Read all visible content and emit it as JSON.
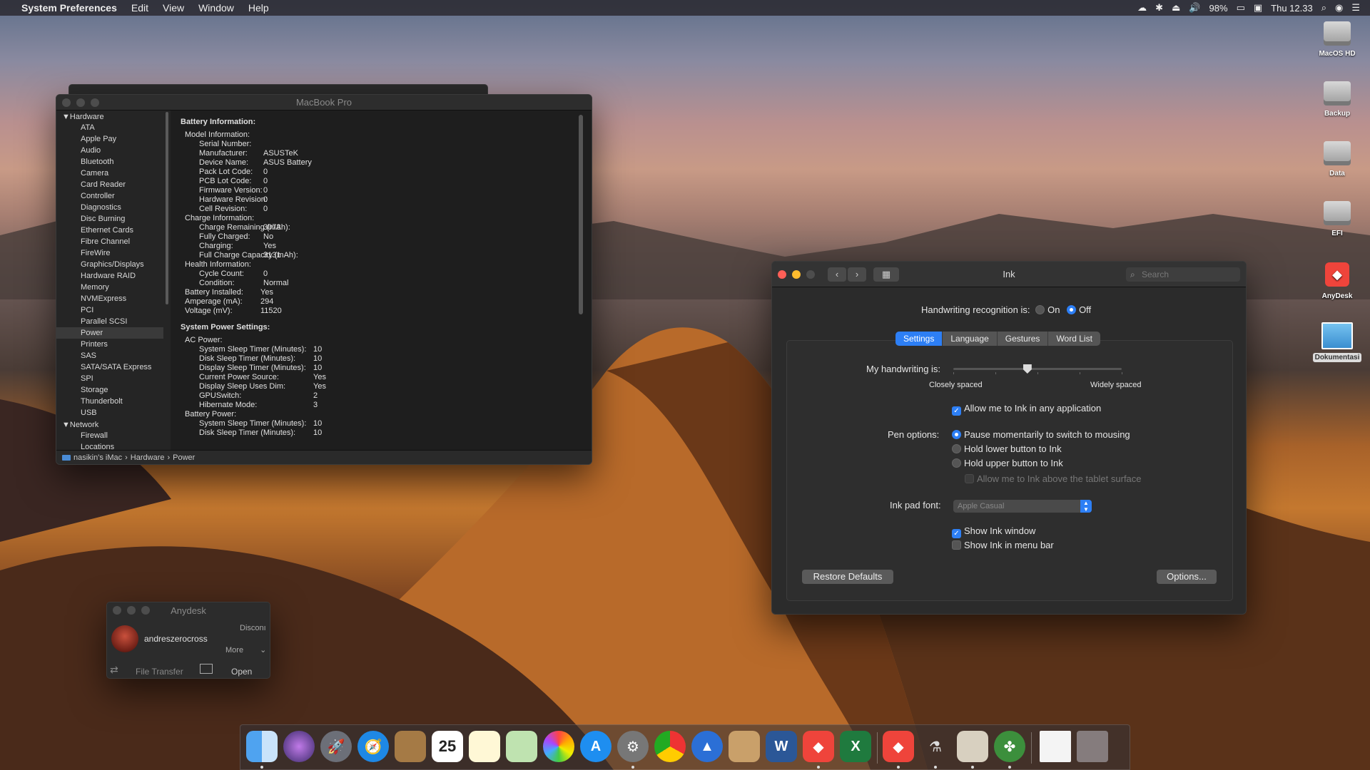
{
  "menubar": {
    "app": "System Preferences",
    "items": [
      "Edit",
      "View",
      "Window",
      "Help"
    ],
    "battery": "98%",
    "clock": "Thu 12.33"
  },
  "sysinfo": {
    "title": "MacBook Pro",
    "sidebar_hardware": "Hardware",
    "hardware_items": [
      "ATA",
      "Apple Pay",
      "Audio",
      "Bluetooth",
      "Camera",
      "Card Reader",
      "Controller",
      "Diagnostics",
      "Disc Burning",
      "Ethernet Cards",
      "Fibre Channel",
      "FireWire",
      "Graphics/Displays",
      "Hardware RAID",
      "Memory",
      "NVMExpress",
      "PCI",
      "Parallel SCSI",
      "Power",
      "Printers",
      "SAS",
      "SATA/SATA Express",
      "SPI",
      "Storage",
      "Thunderbolt",
      "USB"
    ],
    "selected_item": "Power",
    "sidebar_network": "Network",
    "network_items": [
      "Firewall",
      "Locations"
    ],
    "battery_heading": "Battery Information:",
    "battery_rows": [
      {
        "level": 1,
        "key": "Model Information:",
        "val": ""
      },
      {
        "level": 2,
        "key": "Serial Number:",
        "val": ""
      },
      {
        "level": 2,
        "key": "Manufacturer:",
        "val": "ASUSTeK"
      },
      {
        "level": 2,
        "key": "Device Name:",
        "val": "ASUS Battery"
      },
      {
        "level": 2,
        "key": "Pack Lot Code:",
        "val": "0"
      },
      {
        "level": 2,
        "key": "PCB Lot Code:",
        "val": "0"
      },
      {
        "level": 2,
        "key": "Firmware Version:",
        "val": "0"
      },
      {
        "level": 2,
        "key": "Hardware Revision:",
        "val": "0"
      },
      {
        "level": 2,
        "key": "Cell Revision:",
        "val": "0"
      },
      {
        "level": 1,
        "key": "Charge Information:",
        "val": ""
      },
      {
        "level": 2,
        "key": "Charge Remaining (mAh):",
        "val": "3073"
      },
      {
        "level": 2,
        "key": "Fully Charged:",
        "val": "No"
      },
      {
        "level": 2,
        "key": "Charging:",
        "val": "Yes"
      },
      {
        "level": 2,
        "key": "Full Charge Capacity (mAh):",
        "val": "3131"
      },
      {
        "level": 1,
        "key": "Health Information:",
        "val": ""
      },
      {
        "level": 2,
        "key": "Cycle Count:",
        "val": "0"
      },
      {
        "level": 2,
        "key": "Condition:",
        "val": "Normal"
      },
      {
        "level": 1,
        "key": "Battery Installed:",
        "val": "Yes"
      },
      {
        "level": 1,
        "key": "Amperage (mA):",
        "val": "294"
      },
      {
        "level": 1,
        "key": "Voltage (mV):",
        "val": "11520"
      }
    ],
    "power_heading": "System Power Settings:",
    "power_rows": [
      {
        "level": 1,
        "key": "AC Power:",
        "val": ""
      },
      {
        "level": 2,
        "key": "System Sleep Timer (Minutes):",
        "val": "10"
      },
      {
        "level": 2,
        "key": "Disk Sleep Timer (Minutes):",
        "val": "10"
      },
      {
        "level": 2,
        "key": "Display Sleep Timer (Minutes):",
        "val": "10"
      },
      {
        "level": 2,
        "key": "Current Power Source:",
        "val": "Yes"
      },
      {
        "level": 2,
        "key": "Display Sleep Uses Dim:",
        "val": "Yes"
      },
      {
        "level": 2,
        "key": "GPUSwitch:",
        "val": "2"
      },
      {
        "level": 2,
        "key": "Hibernate Mode:",
        "val": "3"
      },
      {
        "level": 1,
        "key": "Battery Power:",
        "val": ""
      },
      {
        "level": 2,
        "key": "System Sleep Timer (Minutes):",
        "val": "10"
      },
      {
        "level": 2,
        "key": "Disk Sleep Timer (Minutes):",
        "val": "10"
      }
    ],
    "path": [
      "nasikin's iMac",
      "Hardware",
      "Power"
    ]
  },
  "ink": {
    "title": "Ink",
    "search_placeholder": "Search",
    "recognition_label": "Handwriting recognition is:",
    "on": "On",
    "off": "Off",
    "tabs": [
      "Settings",
      "Language",
      "Gestures",
      "Word List"
    ],
    "handwriting_label": "My handwriting is:",
    "spacing_level": 0.44,
    "closely": "Closely spaced",
    "widely": "Widely spaced",
    "allow_any": "Allow me to Ink in any application",
    "pen_label": "Pen options:",
    "pen_opt1": "Pause momentarily to switch to mousing",
    "pen_opt2": "Hold lower button to Ink",
    "pen_opt3": "Hold upper button to Ink",
    "allow_above": "Allow me to Ink above the tablet surface",
    "font_label": "Ink pad font:",
    "font_value": "Apple Casual",
    "show_window": "Show Ink window",
    "show_menubar": "Show Ink in menu bar",
    "restore": "Restore Defaults",
    "options": "Options..."
  },
  "anydesk": {
    "title": "Anydesk",
    "user": "andreszerocross",
    "disconnect": "Disconı",
    "more": "More",
    "file_transfer": "File Transfer",
    "open_chat": "Open Cha"
  },
  "desktop": [
    "MacOS HD",
    "Backup",
    "Data",
    "EFI",
    "AnyDesk",
    "Dokumentasi"
  ],
  "colors": {
    "accent": "#2d7ff5",
    "close": "#fe5f57",
    "minimize": "#febc2e",
    "anydesk": "#ef443b"
  }
}
